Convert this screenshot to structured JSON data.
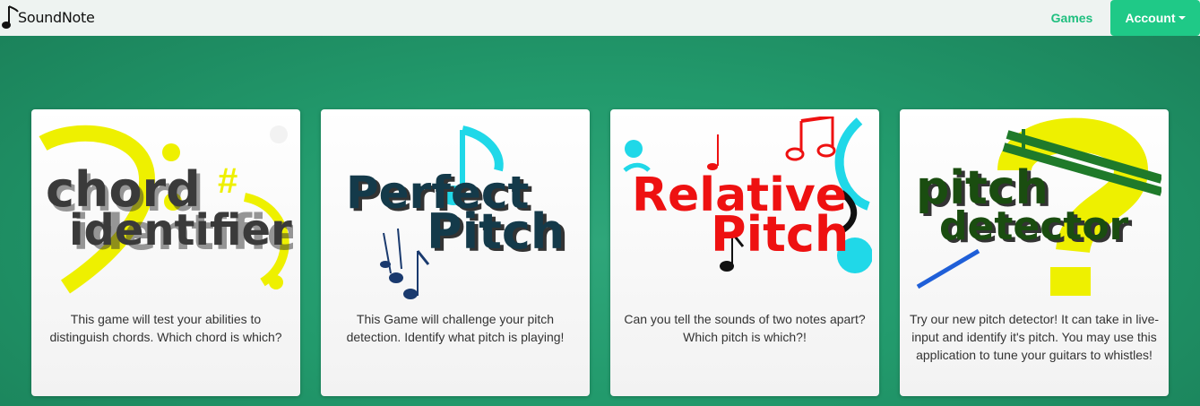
{
  "brand": {
    "name": "SoundNote"
  },
  "nav": {
    "games_label": "Games",
    "account_label": "Account"
  },
  "colors": {
    "accent": "#1fc987",
    "background": "#229a6c",
    "navbar": "#eef3f1"
  },
  "cards": [
    {
      "art": {
        "line1": "chord",
        "line2": "identifier"
      },
      "description": "This game will test your abilities to distinguish chords. Which chord is which?"
    },
    {
      "art": {
        "line1": "Perfect",
        "line2": "Pitch"
      },
      "description": "This Game will challenge your pitch detection. Identify what pitch is playing!"
    },
    {
      "art": {
        "line1": "Relative",
        "line2": "Pitch"
      },
      "description": "Can you tell the sounds of two notes apart? Which pitch is which?!"
    },
    {
      "art": {
        "line1": "pitch",
        "line2": "detector"
      },
      "description": "Try our new pitch detector! It can take in live-input and identify it's pitch. You may use this application to tune your guitars to whistles!"
    }
  ]
}
